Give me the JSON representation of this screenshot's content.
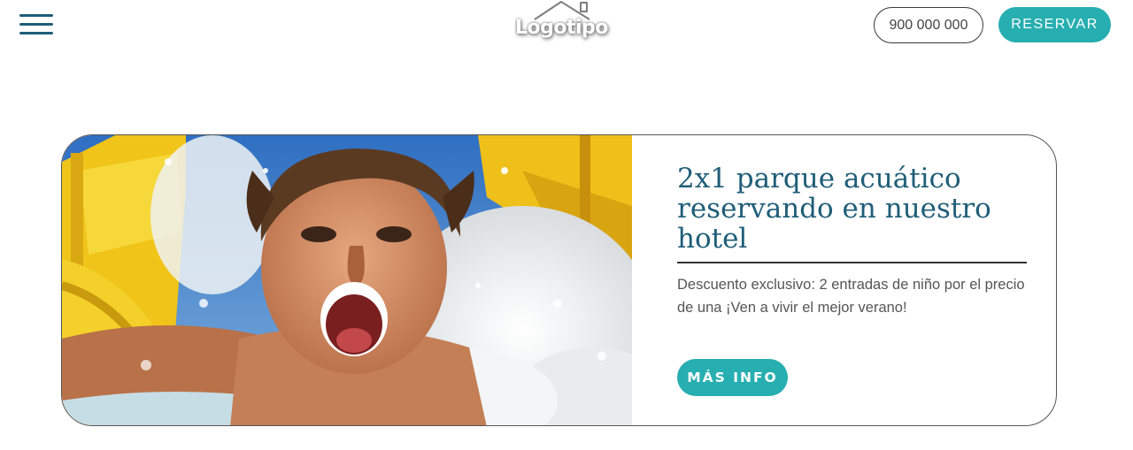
{
  "header": {
    "logo_text": "Logotipo",
    "phone_label": "900 000 000",
    "reserve_label": "RESERVAR"
  },
  "promo": {
    "image_alt": "Niño en un tobogán acuático",
    "title": "2x1 parque acuático reservando en nuestro hotel",
    "description": "Descuento exclusivo: 2 entradas de niño por el precio de una ¡Ven a vivir el mejor verano!",
    "cta_label": "MÁS INFO"
  },
  "colors": {
    "accent": "#27aeb0",
    "brand_dark": "#1f5d78"
  }
}
